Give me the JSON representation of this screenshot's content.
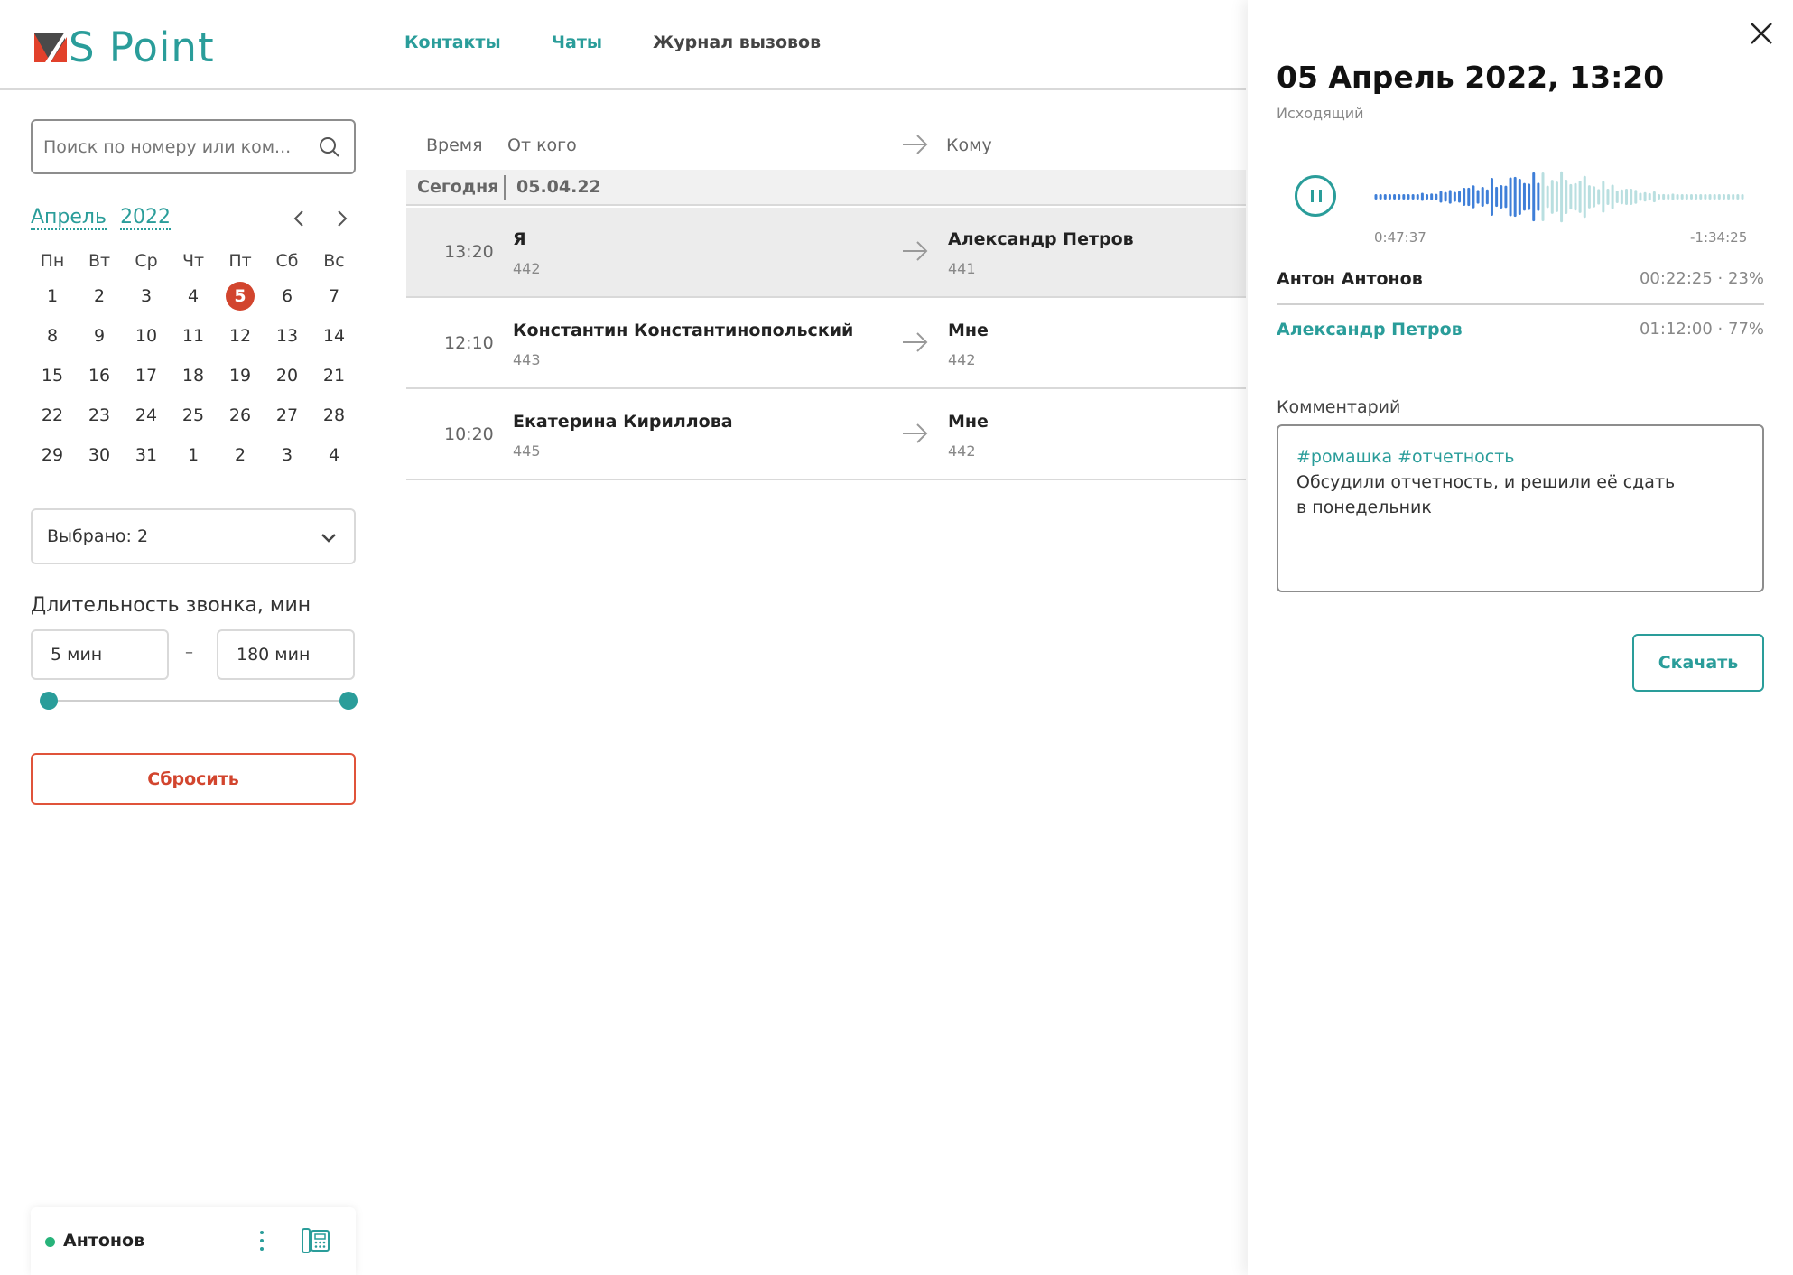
{
  "header": {
    "logo_text": "S Point",
    "nav": [
      {
        "label": "Контакты",
        "active": true
      },
      {
        "label": "Чаты",
        "active": true
      },
      {
        "label": "Журнал вызовов",
        "active": false
      }
    ]
  },
  "filters": {
    "search_placeholder": "Поиск по номеру или ком...",
    "calendar": {
      "month": "Апрель",
      "year": "2022",
      "weekdays": [
        "Пн",
        "Вт",
        "Ср",
        "Чт",
        "Пт",
        "Сб",
        "Вс"
      ],
      "days": [
        "1",
        "2",
        "3",
        "4",
        "5",
        "6",
        "7",
        "8",
        "9",
        "10",
        "11",
        "12",
        "13",
        "14",
        "15",
        "16",
        "17",
        "18",
        "19",
        "20",
        "21",
        "22",
        "23",
        "24",
        "25",
        "26",
        "27",
        "28",
        "29",
        "30",
        "31",
        "1",
        "2",
        "3",
        "4"
      ],
      "selected_day": "5"
    },
    "select_label": "Выбрано: 2",
    "duration_label": "Длительность звонка, мин",
    "duration_from": "5 мин",
    "duration_to": "180 мин",
    "duration_dash": "–",
    "reset_label": "Сбросить"
  },
  "user": {
    "name": "Антонов",
    "status_color": "#27b37a"
  },
  "calls": {
    "headers": {
      "time": "Время",
      "from": "От кого",
      "to": "Кому"
    },
    "group": {
      "label": "Сегодня",
      "date": "05.04.22"
    },
    "rows": [
      {
        "time": "13:20",
        "from": "Я",
        "from_ext": "442",
        "to": "Александр Петров",
        "to_ext": "441",
        "active": true
      },
      {
        "time": "12:10",
        "from": "Константин Константинопольский",
        "from_ext": "443",
        "to": "Мне",
        "to_ext": "442",
        "active": false
      },
      {
        "time": "10:20",
        "from": "Екатерина Кириллова",
        "from_ext": "445",
        "to": "Мне",
        "to_ext": "442",
        "active": false
      }
    ]
  },
  "detail": {
    "title": "05 Апрель 2022, 13:20",
    "direction": "Исходящий",
    "player": {
      "current": "0:47:37",
      "remaining": "-1:34:25",
      "progress": 0.45,
      "played_color": "#3f7fd8",
      "rest_color": "#b9dfe0"
    },
    "speakers": [
      {
        "name": "Антон Антонов",
        "stat": "00:22:25 · 23%"
      },
      {
        "name": "Александр Петров",
        "stat": "01:12:00 · 77%"
      }
    ],
    "comment_label": "Комментарий",
    "comment_tags": "#ромашка #отчетность",
    "comment_text": "Обсудили отчетность, и решили её сдать в понедельник",
    "download_label": "Скачать"
  },
  "colors": {
    "accent": "#2a9d9a",
    "danger": "#d2452e"
  }
}
